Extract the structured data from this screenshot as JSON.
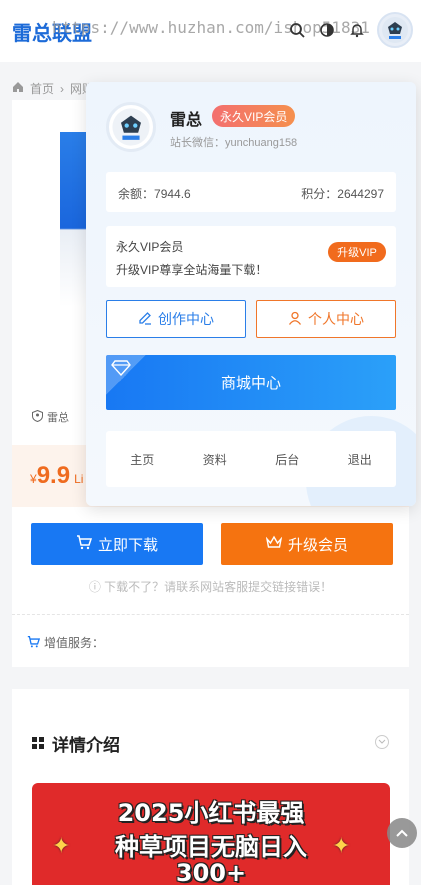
{
  "header": {
    "logo_text": "雷总联盟",
    "watermark": "https://www.huzhan.com/ishop51831",
    "icons": [
      "search-icon",
      "theme-toggle-icon",
      "bell-icon",
      "avatar"
    ]
  },
  "breadcrumb": {
    "home": "首页",
    "current": "网赚"
  },
  "product": {
    "author": "雷总",
    "price_symbol": "¥",
    "price": "9.9",
    "price_unit": "Li",
    "download_button": "立即下载",
    "upgrade_button": "升级会员",
    "download_tip": "下载不了？请联系网站客服提交链接错误！",
    "addon_label": "增值服务："
  },
  "detail": {
    "title": "详情介绍",
    "banner_line1": "2025小红书最强",
    "banner_line2": "种草项目无脑日入",
    "banner_line3": "300+"
  },
  "user_panel": {
    "name": "雷总",
    "badge": "永久VIP会员",
    "wechat": "站长微信：yunchuang158",
    "balance_label": "余额：",
    "balance_value": "7944.6",
    "points_label": "积分：",
    "points_value": "2644297",
    "vip_title": "永久VIP会员",
    "vip_desc": "升级VIP尊享全站海量下载！",
    "vip_button": "升级VIP",
    "create_button": "创作中心",
    "user_button": "个人中心",
    "shop_button": "商城中心",
    "links": [
      "主页",
      "资料",
      "后台",
      "退出"
    ]
  },
  "colors": {
    "primary": "#1878f3",
    "accent": "#f57310",
    "brand": "#1d6bd8"
  }
}
